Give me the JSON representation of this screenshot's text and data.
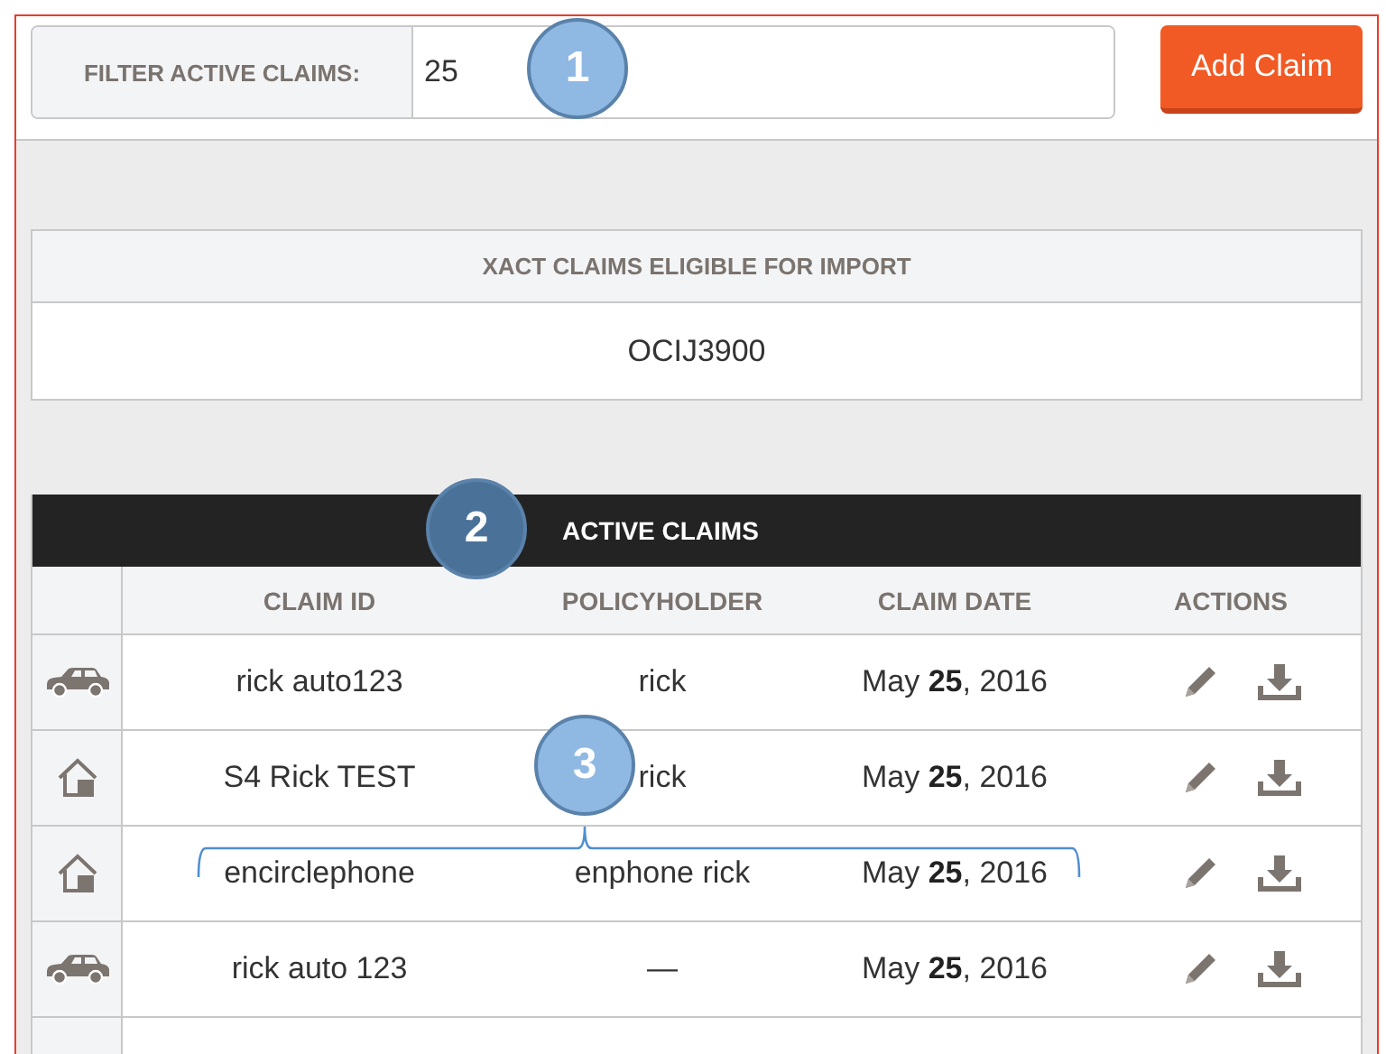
{
  "filter": {
    "label": "FILTER ACTIVE CLAIMS:",
    "value": "25"
  },
  "add_button": "Add Claim",
  "import_panel": {
    "title": "XACT CLAIMS ELIGIBLE FOR IMPORT",
    "items": [
      "OCIJ3900"
    ]
  },
  "active_claims": {
    "title": "ACTIVE CLAIMS",
    "columns": [
      "CLAIM ID",
      "POLICYHOLDER",
      "CLAIM DATE",
      "ACTIONS"
    ],
    "rows": [
      {
        "kind": "vehicle",
        "claim_id": "rick auto123",
        "policyholder": "rick",
        "date": "May **25**, 2016"
      },
      {
        "kind": "home",
        "claim_id": "S4 Rick TEST",
        "policyholder": "rick",
        "date": "May **25**, 2016"
      },
      {
        "kind": "home",
        "claim_id": "encirclephone",
        "policyholder": "enphone rick",
        "date": "May **25**, 2016"
      },
      {
        "kind": "vehicle",
        "claim_id": "rick auto 123",
        "policyholder": "—",
        "date": "May **25**, 2016"
      }
    ]
  },
  "callouts": [
    {
      "number": "1",
      "kind": "plain",
      "color": "#8fb9e2"
    },
    {
      "number": "2",
      "kind": "plain",
      "color": "#4a7299"
    },
    {
      "number": "3",
      "kind": "bracketed",
      "color": "#8fb9e2"
    }
  ]
}
